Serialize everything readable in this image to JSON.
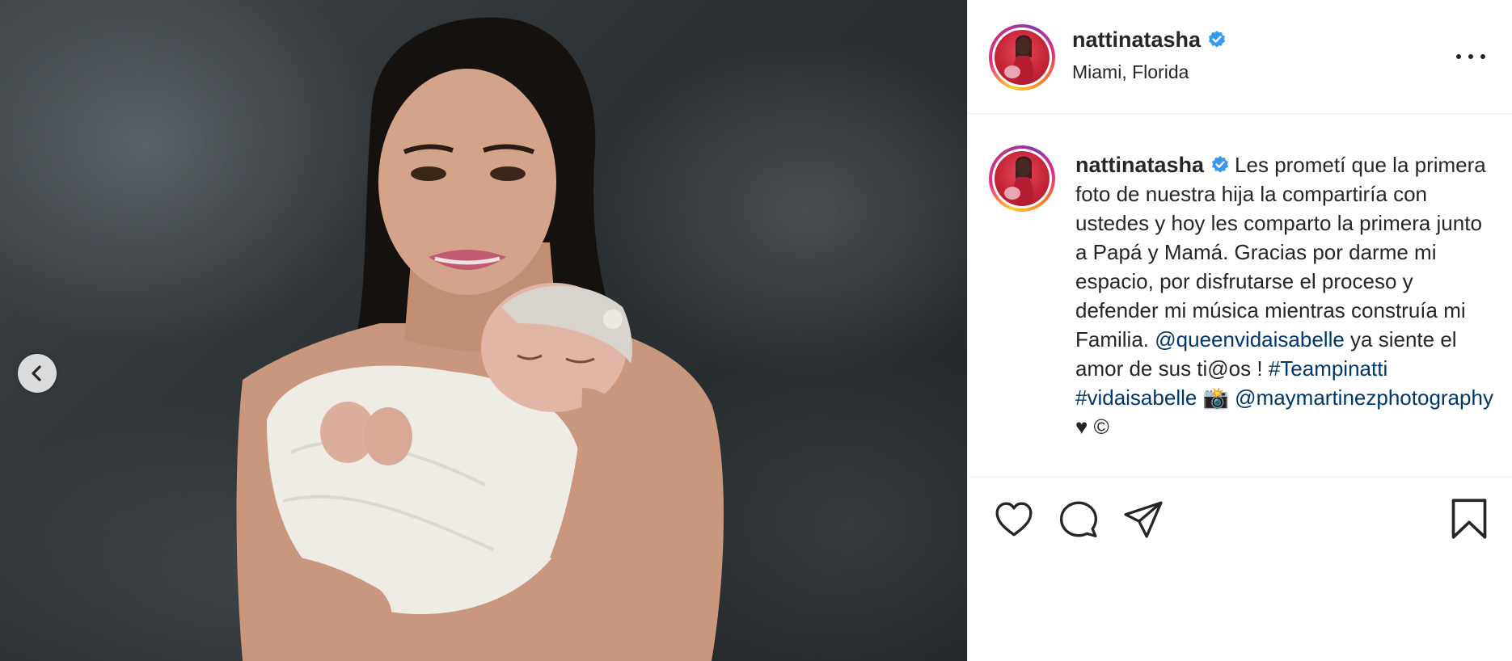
{
  "photo": {
    "alt_description": "",
    "nav": {
      "prev_icon": "chevron-left-icon"
    }
  },
  "header": {
    "username": "nattinatasha",
    "location": "Miami, Florida",
    "verified_icon": "verified-badge-icon",
    "more_icon": "more-options-icon"
  },
  "caption": {
    "username": "nattinatasha",
    "text_1": "Les prometí que la primera foto de nuestra hija la compartiría con ustedes y hoy les comparto la primera junto a Papá y Mamá. Gracias por darme mi espacio, por disfrutarse el proceso y defender mi música mientras construía mi Familia. ",
    "mention_1": "@queenvidaisabelle",
    "text_2": " ya siente el amor de sus ti@os ! ",
    "hashtag_1": "#Teampinatti",
    "hashtag_2": "#vidaisabelle",
    "emoji_camera": "📸",
    "mention_2": "@maymartinezphotography",
    "text_3": " ♥ ©"
  },
  "actions": {
    "like_icon": "heart-icon",
    "comment_icon": "comment-icon",
    "share_icon": "share-icon",
    "save_icon": "bookmark-icon"
  },
  "colors": {
    "link": "#00376b",
    "text": "#262626",
    "verified": "#3897f0",
    "divider": "#efefef"
  }
}
